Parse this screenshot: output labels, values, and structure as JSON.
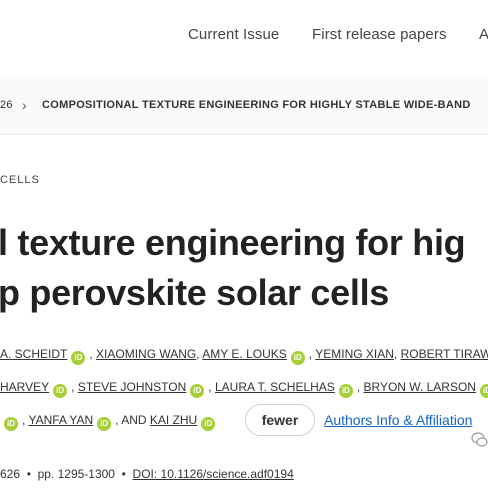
{
  "nav": {
    "current_issue": "Current Issue",
    "first_release": "First release papers",
    "overflow": "A"
  },
  "breadcrumb": {
    "prefix": "26",
    "current": "COMPOSITIONAL TEXTURE ENGINEERING FOR HIGHLY STABLE WIDE-BAND"
  },
  "section_label": "CELLS",
  "title": {
    "line1": "l texture engineering for hig",
    "line2": "p perovskite solar cells"
  },
  "authors": {
    "row1": {
      "a1": "A. SCHEIDT",
      "a2": "XIAOMING WANG",
      "a3": "AMY E. LOUKS",
      "a4": "YEMING XIAN",
      "a5": "ROBERT TIRAW"
    },
    "row2": {
      "a1": "HARVEY",
      "a2": "STEVE JOHNSTON",
      "a3": "LAURA T. SCHELHAS",
      "a4": "BRYON W. LARSON"
    },
    "row3": {
      "a1": "YANFA YAN",
      "and": "AND",
      "a2": "KAI ZHU"
    },
    "sep": ",",
    "orcid_glyph": "iD"
  },
  "fewer_label": "fewer",
  "affiliations_label": "Authors Info & Affiliation",
  "meta": {
    "issue": "626",
    "dot": "•",
    "pages": "pp. 1295-1300",
    "doi": "DOI: 10.1126/science.adf0194"
  },
  "colors": {
    "orcid": "#a6ce39",
    "link": "#1565c0"
  }
}
